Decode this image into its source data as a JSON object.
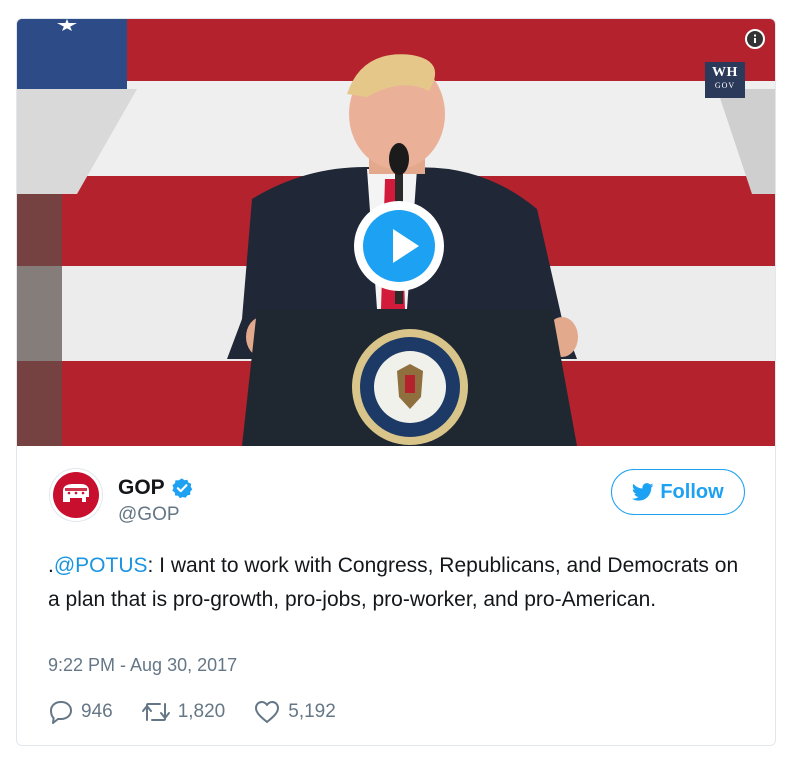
{
  "media": {
    "badge_line1": "WH",
    "badge_line2": "GOV",
    "info_icon": "info-icon",
    "play_icon": "play-icon"
  },
  "account": {
    "name": "GOP",
    "handle": "@GOP",
    "verified_icon": "verified-badge-icon",
    "avatar_icon": "elephant-logo"
  },
  "follow_button": {
    "label": "Follow",
    "icon": "twitter-bird-icon"
  },
  "tweet": {
    "mention": "@POTUS",
    "prefix": ".",
    "body": ": I want to work with Congress, Republicans, and Democrats on a plan that is pro-growth, pro-jobs, pro-worker, and pro-American.",
    "timestamp": "9:22 PM - Aug 30, 2017"
  },
  "actions": {
    "replies": "946",
    "retweets": "1,820",
    "likes": "5,192"
  },
  "colors": {
    "accent": "#1da1f2",
    "link": "#1b95e0",
    "muted": "#657786",
    "gop_red": "#c8102e"
  }
}
